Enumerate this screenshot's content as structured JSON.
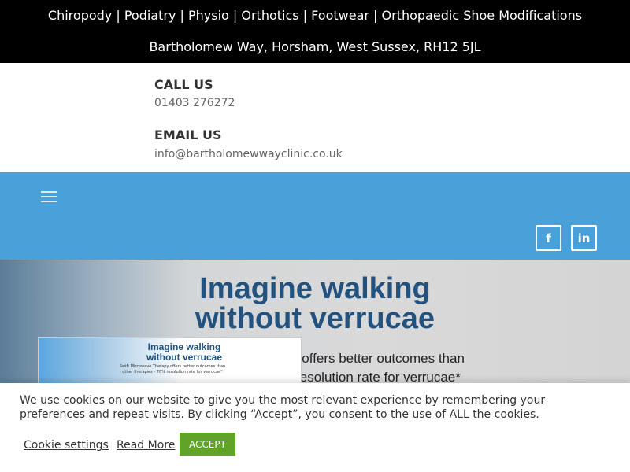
{
  "topbar": {
    "services": "Chiropody | Podiatry | Physio | Orthotics | Footwear | Orthopaedic Shoe Modifications",
    "address": "Bartholomew Way, Horsham, West Sussex, RH12 5JL"
  },
  "contact": {
    "call_heading": "CALL US",
    "phone": "01403 276272",
    "email_heading": "EMAIL US",
    "email": "info@bartholomewwayclinic.co.uk"
  },
  "nav": {
    "menu_icon": "hamburger-icon",
    "facebook_label": "f",
    "linkedin_label": "in",
    "background": "#4aa0d8"
  },
  "hero": {
    "headline_line1": "Imagine walking",
    "headline_line2": "without verrucae",
    "sub_line1": "y offers better outcomes than",
    "sub_line2": "resolution rate for verrucae*",
    "card_title_line1": "Imagine walking",
    "card_title_line2": "without verrucae",
    "card_sub_line1": "Swift Microwave Therapy offers better outcomes than",
    "card_sub_line2": "other therapies - 76% resolution rate for verrucae*"
  },
  "cookie": {
    "message": "We use cookies on our website to give you the most relevant experience by remembering your preferences and repeat visits. By clicking “Accept”, you consent to the use of ALL the cookies.",
    "settings_label": "Cookie settings",
    "read_more_label": "Read More",
    "accept_label": "ACCEPT",
    "accept_color": "#61a229"
  }
}
